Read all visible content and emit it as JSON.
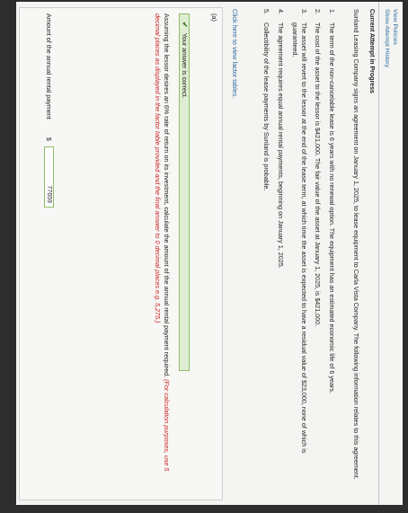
{
  "nav": {
    "view_policies": "View Policies",
    "show_attempt_history": "Show Attempt History"
  },
  "attempt_title": "Current Attempt in Progress",
  "intro": "Sunland Leasing Company signs an agreement on January 1, 2025, to lease equipment to Carla Vista Company. The following information relates to this agreement.",
  "items": [
    {
      "num": "1.",
      "text": "The term of the non-cancelable lease is 6 years with no renewal option. The equipment has an estimated economic life of 6 years."
    },
    {
      "num": "2.",
      "text": "The cost of the asset to the lessor is $421,000. The fair value of the asset at January 1, 2025, is $421,000."
    },
    {
      "num": "3.",
      "text": "The asset will revert to the lessor at the end of the lease term, at which time the asset is expected to have a residual value of $23,000, none of which is guaranteed."
    },
    {
      "num": "4.",
      "text": "The agreement requires equal annual rental payments, beginning on January 1, 2025."
    },
    {
      "num": "5.",
      "text": "Collectibility of the lease payments by Sunland is probable."
    }
  ],
  "factor_link": "Click here to view factor tables.",
  "part": {
    "label": "(a)",
    "status": "Your answer is correct.",
    "question": "Assuming the lessor desires an 6% rate of return on its investment, calculate the amount of the annual rental payment required.",
    "hint": "(For calculation purposes, use 5 decimal places as displayed in the factor table provided and the final answer to 0 decimal places e.g. 5,275.)",
    "answer_label": "Amount of the annual rental payment",
    "currency": "$",
    "answer_value": "77659"
  },
  "colors": {
    "link": "#2c6aa0",
    "correct_bg": "#dfeed3",
    "correct_border": "#8fbf6a",
    "hint": "#c81e1e"
  }
}
